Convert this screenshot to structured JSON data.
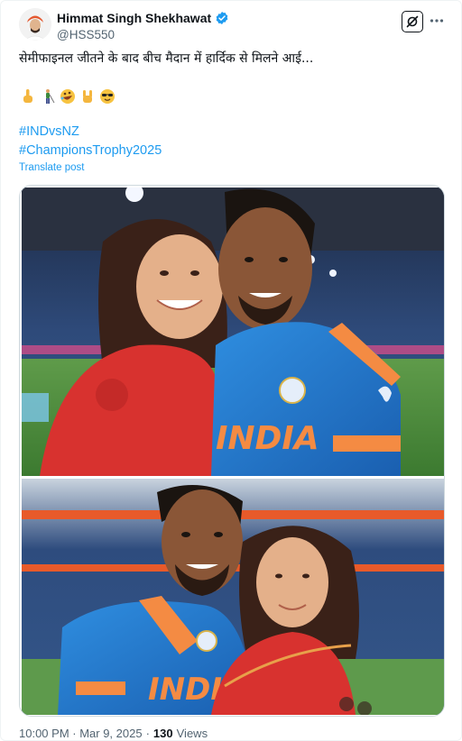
{
  "author": {
    "display_name": "Himmat Singh Shekhawat",
    "handle": "@HSS550",
    "verified": true,
    "verified_color": "#1d9bf0"
  },
  "tweet": {
    "text": "सेमीफाइनल जीतने के बाद बीच मैदान में हार्दिक से मिलने आई...",
    "emojis": [
      "pointing-up",
      "person-golfing",
      "rolling-laughing",
      "rock-on-hand",
      "smiling-sunglasses"
    ],
    "hashtags": [
      "#INDvsNZ",
      "#ChampionsTrophy2025"
    ],
    "translate_label": "Translate post"
  },
  "media": {
    "count": 2,
    "photos": [
      "photo-1",
      "photo-2"
    ]
  },
  "footer": {
    "timestamp": "10:00 PM · Mar 9, 2025",
    "separator": "·",
    "views_count": "130",
    "views_label": "Views"
  },
  "colors": {
    "link": "#1d9bf0",
    "text": "#0f1419",
    "muted": "#536471"
  }
}
